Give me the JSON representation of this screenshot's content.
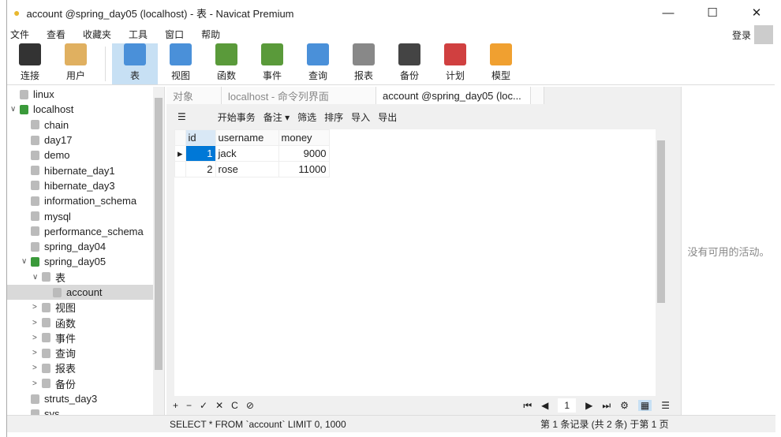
{
  "window": {
    "title": "account @spring_day05 (localhost) - 表 - Navicat Premium",
    "minimize": "—",
    "maximize": "☐",
    "close": "✕"
  },
  "menu": [
    "文件",
    "查看",
    "收藏夹",
    "工具",
    "窗口",
    "帮助"
  ],
  "login": "登录",
  "toolbar": [
    {
      "label": "连接",
      "color": "#333"
    },
    {
      "label": "用户",
      "color": "#e0b060"
    },
    {
      "label": "表",
      "color": "#4a90d9",
      "active": true
    },
    {
      "label": "视图",
      "color": "#4a90d9"
    },
    {
      "label": "函数",
      "color": "#5a9a3a"
    },
    {
      "label": "事件",
      "color": "#5a9a3a"
    },
    {
      "label": "查询",
      "color": "#4a90d9"
    },
    {
      "label": "报表",
      "color": "#888"
    },
    {
      "label": "备份",
      "color": "#444"
    },
    {
      "label": "计划",
      "color": "#d04040"
    },
    {
      "label": "模型",
      "color": "#f0a030"
    }
  ],
  "tree": [
    {
      "label": "linux",
      "level": 0,
      "arrow": ""
    },
    {
      "label": "localhost",
      "level": 0,
      "arrow": "∨",
      "color": "#3a9a3a"
    },
    {
      "label": "chain",
      "level": 1
    },
    {
      "label": "day17",
      "level": 1
    },
    {
      "label": "demo",
      "level": 1
    },
    {
      "label": "hibernate_day1",
      "level": 1
    },
    {
      "label": "hibernate_day3",
      "level": 1
    },
    {
      "label": "information_schema",
      "level": 1
    },
    {
      "label": "mysql",
      "level": 1
    },
    {
      "label": "performance_schema",
      "level": 1
    },
    {
      "label": "spring_day04",
      "level": 1
    },
    {
      "label": "spring_day05",
      "level": 1,
      "arrow": "∨",
      "color": "#3a9a3a"
    },
    {
      "label": "表",
      "level": 2,
      "arrow": "∨"
    },
    {
      "label": "account",
      "level": 3,
      "selected": true
    },
    {
      "label": "视图",
      "level": 2,
      "arrow": ">"
    },
    {
      "label": "函数",
      "level": 2,
      "arrow": ">"
    },
    {
      "label": "事件",
      "level": 2,
      "arrow": ">"
    },
    {
      "label": "查询",
      "level": 2,
      "arrow": ">"
    },
    {
      "label": "报表",
      "level": 2,
      "arrow": ">"
    },
    {
      "label": "备份",
      "level": 2,
      "arrow": ">"
    },
    {
      "label": "struts_day3",
      "level": 1
    },
    {
      "label": "sys",
      "level": 1
    }
  ],
  "tabs": [
    {
      "label": "对象"
    },
    {
      "label": "localhost - 命令列界面"
    },
    {
      "label": "account @spring_day05 (loc...",
      "active": true
    }
  ],
  "subtoolbar": [
    "☰",
    "开始事务",
    "备注 ▾",
    "筛选",
    "排序",
    "导入",
    "导出"
  ],
  "table": {
    "columns": [
      "id",
      "username",
      "money"
    ],
    "rows": [
      [
        "1",
        "jack",
        "9000"
      ],
      [
        "2",
        "rose",
        "11000"
      ]
    ]
  },
  "bottom_tools": [
    "+",
    "−",
    "✓",
    "✕",
    "C",
    "⊘"
  ],
  "pager": {
    "page": "1"
  },
  "right_panel": "没有可用的活动。",
  "status": {
    "sql": "SELECT * FROM `account` LIMIT 0, 1000",
    "record": "第 1 条记录 (共 2 条) 于第 1 页"
  }
}
